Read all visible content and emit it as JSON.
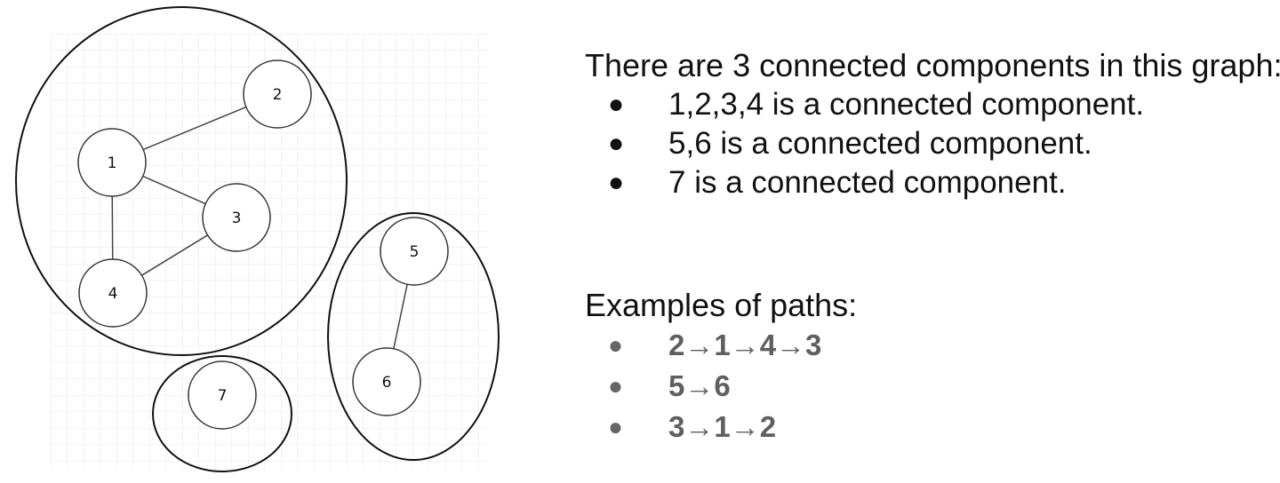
{
  "graph": {
    "nodes": [
      {
        "id": "1",
        "label": "1"
      },
      {
        "id": "2",
        "label": "2"
      },
      {
        "id": "3",
        "label": "3"
      },
      {
        "id": "4",
        "label": "4"
      },
      {
        "id": "5",
        "label": "5"
      },
      {
        "id": "6",
        "label": "6"
      },
      {
        "id": "7",
        "label": "7"
      }
    ],
    "edges": [
      [
        "1",
        "2"
      ],
      [
        "1",
        "3"
      ],
      [
        "1",
        "4"
      ],
      [
        "3",
        "4"
      ],
      [
        "5",
        "6"
      ]
    ],
    "components": [
      [
        "1",
        "2",
        "3",
        "4"
      ],
      [
        "5",
        "6"
      ],
      [
        "7"
      ]
    ]
  },
  "text": {
    "heading": "There are 3 connected components in this graph:",
    "components": [
      "1,2,3,4 is a connected component.",
      "5,6 is a connected component.",
      "7 is a connected component."
    ],
    "examples_heading": "Examples of paths:",
    "paths": [
      "2→1→4→3",
      "5→6",
      "3→1→2"
    ],
    "bullet": "●"
  }
}
